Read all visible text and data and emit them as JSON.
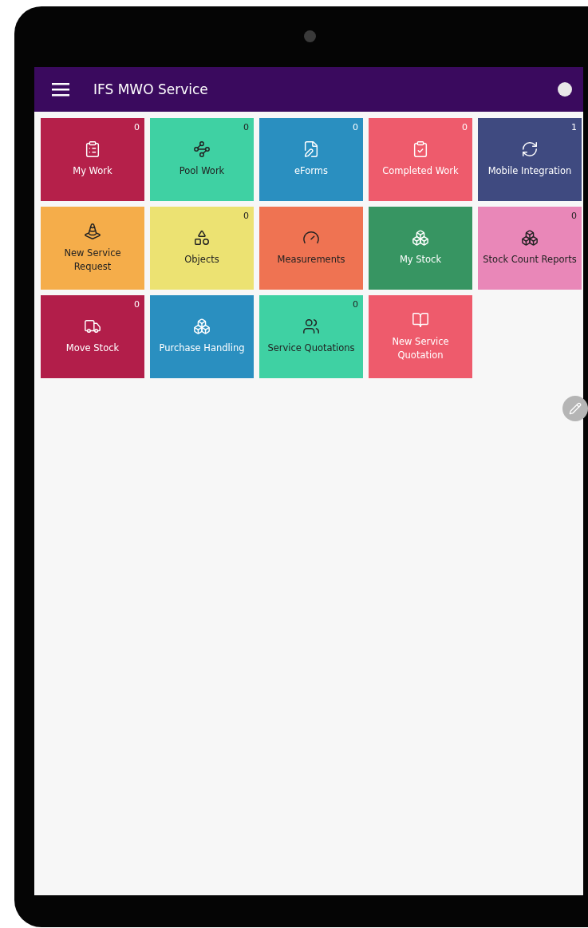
{
  "app_bar": {
    "title": "IFS MWO Service"
  },
  "tiles": [
    {
      "label": "My Work",
      "count": "0",
      "color": "#b5204a",
      "dark_text": false
    },
    {
      "label": "Pool Work",
      "count": "0",
      "color": "#3fd1a3",
      "dark_text": true
    },
    {
      "label": "eForms",
      "count": "0",
      "color": "#2a8fc0",
      "dark_text": false
    },
    {
      "label": "Completed Work",
      "count": "0",
      "color": "#ee5b6c",
      "dark_text": false
    },
    {
      "label": "Mobile Integration",
      "count": "1",
      "color": "#3f4a80",
      "dark_text": false
    },
    {
      "label": "New Service Request",
      "color": "#f5ad4a",
      "dark_text": true
    },
    {
      "label": "Objects",
      "count": "0",
      "color": "#ece272",
      "dark_text": true
    },
    {
      "label": "Measurements",
      "color": "#ef7352",
      "dark_text": true
    },
    {
      "label": "My Stock",
      "color": "#379562",
      "dark_text": false
    },
    {
      "label": "Stock Count Reports",
      "count": "0",
      "color": "#e987b8",
      "dark_text": true
    },
    {
      "label": "Move Stock",
      "count": "0",
      "color": "#b21e4a",
      "dark_text": false
    },
    {
      "label": "Purchase Handling",
      "color": "#2a8fc0",
      "dark_text": false
    },
    {
      "label": "Service Quotations",
      "count": "0",
      "color": "#3fd1a3",
      "dark_text": true
    },
    {
      "label": "New Service Quotation",
      "color": "#ee5b6c",
      "dark_text": false
    }
  ]
}
